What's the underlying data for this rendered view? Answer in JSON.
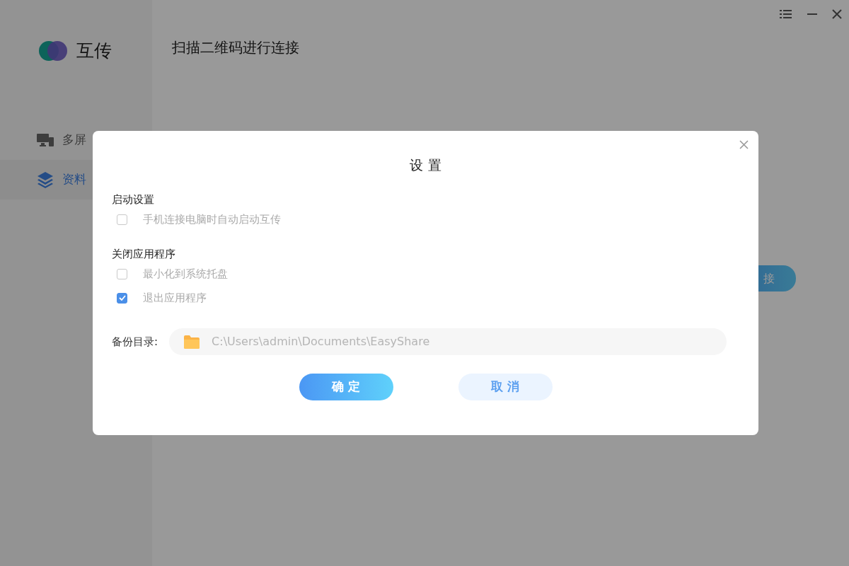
{
  "app": {
    "logo_text": "互传",
    "heading": "扫描二维码进行连接",
    "sidebar": {
      "items": [
        {
          "label": "多屏",
          "kind": "screens",
          "selected": false
        },
        {
          "label": "资料",
          "kind": "layers",
          "selected": true
        }
      ]
    },
    "connect_button": "接"
  },
  "dialog": {
    "title": "设 置",
    "sections": [
      {
        "heading": "启动设置",
        "options": [
          {
            "label": "手机连接电脑时自动启动互传",
            "checked": false
          }
        ]
      },
      {
        "heading": "关闭应用程序",
        "options": [
          {
            "label": "最小化到系统托盘",
            "checked": false
          },
          {
            "label": "退出应用程序",
            "checked": true
          }
        ]
      }
    ],
    "backup": {
      "label": "备份目录:",
      "value": "C:\\Users\\admin\\Documents\\EasyShare"
    },
    "buttons": [
      {
        "label": "确 定",
        "kind": "primary"
      },
      {
        "label": "取 消",
        "kind": "secondary"
      }
    ]
  }
}
